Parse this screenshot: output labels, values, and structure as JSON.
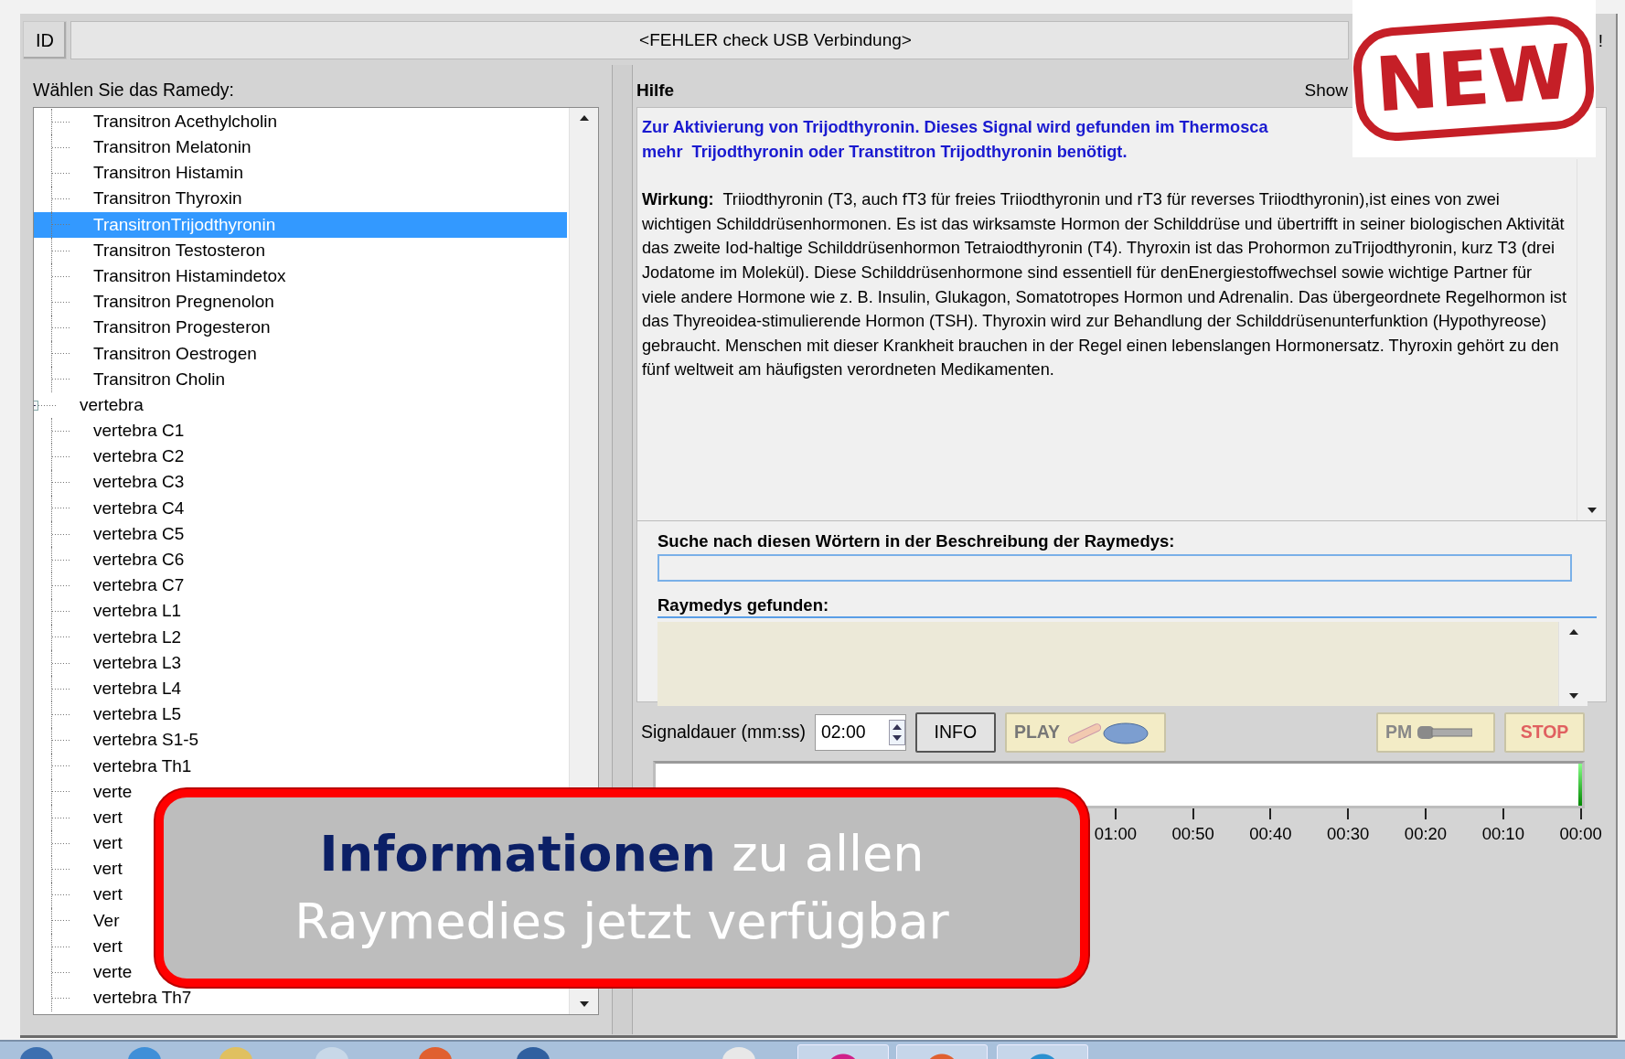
{
  "top_bar": {
    "id_label": "ID",
    "status": "<FEHLER check USB Verbindung>",
    "trailing": "!"
  },
  "left_panel": {
    "title": "Wählen Sie das Ramedy:",
    "tree": [
      {
        "children": [
          {
            "label": "Transitron Acethylcholin",
            "selected": false
          },
          {
            "label": "Transitron Melatonin",
            "selected": false
          },
          {
            "label": "Transitron Histamin",
            "selected": false
          },
          {
            "label": "Transitron Thyroxin",
            "selected": false
          },
          {
            "label": "TransitronTrijodthyronin",
            "selected": true
          },
          {
            "label": "Transitron Testosteron",
            "selected": false
          },
          {
            "label": "Transitron Histamindetox",
            "selected": false
          },
          {
            "label": "Transitron Pregnenolon",
            "selected": false
          },
          {
            "label": "Transitron Progesteron",
            "selected": false
          },
          {
            "label": "Transitron Oestrogen",
            "selected": false
          },
          {
            "label": "Transitron Cholin",
            "selected": false
          }
        ]
      },
      {
        "label": "vertebra",
        "selected": false,
        "expanded": true,
        "children": [
          {
            "label": "vertebra C1",
            "selected": false
          },
          {
            "label": "vertebra C2",
            "selected": false
          },
          {
            "label": "vertebra C3",
            "selected": false
          },
          {
            "label": "vertebra C4",
            "selected": false
          },
          {
            "label": "vertebra C5",
            "selected": false
          },
          {
            "label": "vertebra C6",
            "selected": false
          },
          {
            "label": "vertebra C7",
            "selected": false
          },
          {
            "label": "vertebra L1",
            "selected": false
          },
          {
            "label": "vertebra L2",
            "selected": false
          },
          {
            "label": "vertebra L3",
            "selected": false
          },
          {
            "label": "vertebra L4",
            "selected": false
          },
          {
            "label": "vertebra L5",
            "selected": false
          },
          {
            "label": "vertebra S1-5",
            "selected": false
          },
          {
            "label": "vertebra Th1",
            "selected": false
          },
          {
            "label": "verte",
            "selected": false
          },
          {
            "label": "vert",
            "selected": false
          },
          {
            "label": "vert",
            "selected": false
          },
          {
            "label": "vert",
            "selected": false
          },
          {
            "label": "vert",
            "selected": false
          },
          {
            "label": "Ver",
            "selected": false
          },
          {
            "label": "vert",
            "selected": false
          },
          {
            "label": "verte",
            "selected": false
          },
          {
            "label": "vertebra Th7",
            "selected": false
          }
        ]
      }
    ]
  },
  "help": {
    "title": "Hilfe",
    "show_label": "Show",
    "intro_lines": [
      "Zur Aktivierung von Trijodthyronin. Dieses Signal wird gefunden im Thermosca",
      "mehr  Trijodthyronin oder Transtitron Trijodthyronin benötigt."
    ],
    "body": "**Wirkung:**  Triiodthyronin (T3, auch fT3 für freies Triiodthyronin und rT3 für reverses Triiodthyronin),ist eines von zwei wichtigen Schilddrüsenhormonen. Es ist das wirksamste Hormon der Schilddrüse und übertrifft in seiner biologischen Aktivität das zweite Iod-haltige Schilddrüsenhormon Tetraiodthyronin (T4). Thyroxin ist das Prohormon zuTrijodthyronin, kurz T3 (drei Jodatome im Molekül). Diese Schilddrüsenhormone sind essentiell für denEnergiestoffwechsel sowie wichtige Partner für viele andere Hormone wie z. B. Insulin, Glukagon, Somatotropes Hormon und Adrenalin. Das übergeordnete Regelhormon ist das Thyreoidea-stimulierende Hormon (TSH). Thyroxin wird zur Behandlung der Schilddrüsenunterfunktion (Hypothyreose) gebraucht. Menschen mit dieser Krankheit brauchen in der Regel einen lebenslangen Hormonersatz. Thyroxin gehört zu den fünf weltweit am häufigsten verordneten Medikamenten."
  },
  "search": {
    "label": "Suche nach diesen Wörtern in der Beschreibung der Raymedys:",
    "results_label": "Raymedys gefunden:"
  },
  "controls": {
    "duration_label": "Signaldauer (mm:ss)",
    "duration": "02:00",
    "buttons": [
      {
        "kind": "info",
        "label": "INFO"
      },
      {
        "kind": "play",
        "label": "PLAY"
      },
      {
        "kind": "pm",
        "label": "PM"
      },
      {
        "kind": "stop",
        "label": "STOP"
      }
    ]
  },
  "timeline": {
    "ticks": [
      "01:00",
      "00:50",
      "00:40",
      "00:30",
      "00:20",
      "00:10",
      "00:00"
    ]
  },
  "callout": {
    "lines": [
      "**Informationen** zu allen",
      "Raymedies jetzt verfügbar"
    ]
  },
  "stamp": {
    "text": "NEW"
  }
}
